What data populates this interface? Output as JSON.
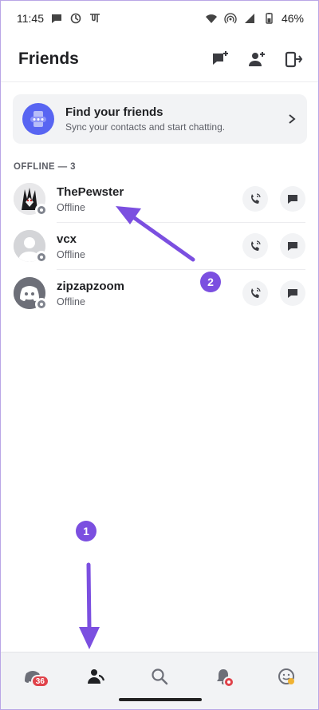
{
  "status_bar": {
    "time": "11:45",
    "battery": "46%",
    "icons": [
      "chat-bubble-icon",
      "vpn-icon",
      "devanagari-pe-icon",
      "wifi-icon",
      "hotspot-icon",
      "signal-icon",
      "battery-icon"
    ]
  },
  "header": {
    "title": "Friends",
    "actions": [
      "new-message-icon",
      "add-friend-icon",
      "exit-icon"
    ]
  },
  "find_card": {
    "title": "Find your friends",
    "subtitle": "Sync your contacts and start chatting."
  },
  "section": {
    "label": "OFFLINE — 3"
  },
  "friends": [
    {
      "name": "ThePewster",
      "status": "Offline",
      "avatar": "anime-character-avatar"
    },
    {
      "name": "vcx",
      "status": "Offline",
      "avatar": "default-gray-avatar"
    },
    {
      "name": "zipzapzoom",
      "status": "Offline",
      "avatar": "discord-default-avatar"
    }
  ],
  "annotations": [
    {
      "label": "1"
    },
    {
      "label": "2"
    }
  ],
  "bottom_nav": {
    "items": [
      {
        "icon": "servers-icon",
        "badge": "36"
      },
      {
        "icon": "friends-icon",
        "active": true
      },
      {
        "icon": "search-icon"
      },
      {
        "icon": "notifications-icon",
        "dot": "red"
      },
      {
        "icon": "profile-icon",
        "dot": "yellow"
      }
    ]
  },
  "colors": {
    "accent": "#5865f2",
    "annotation": "#7b4fe0",
    "badge_red": "#e0424a"
  }
}
